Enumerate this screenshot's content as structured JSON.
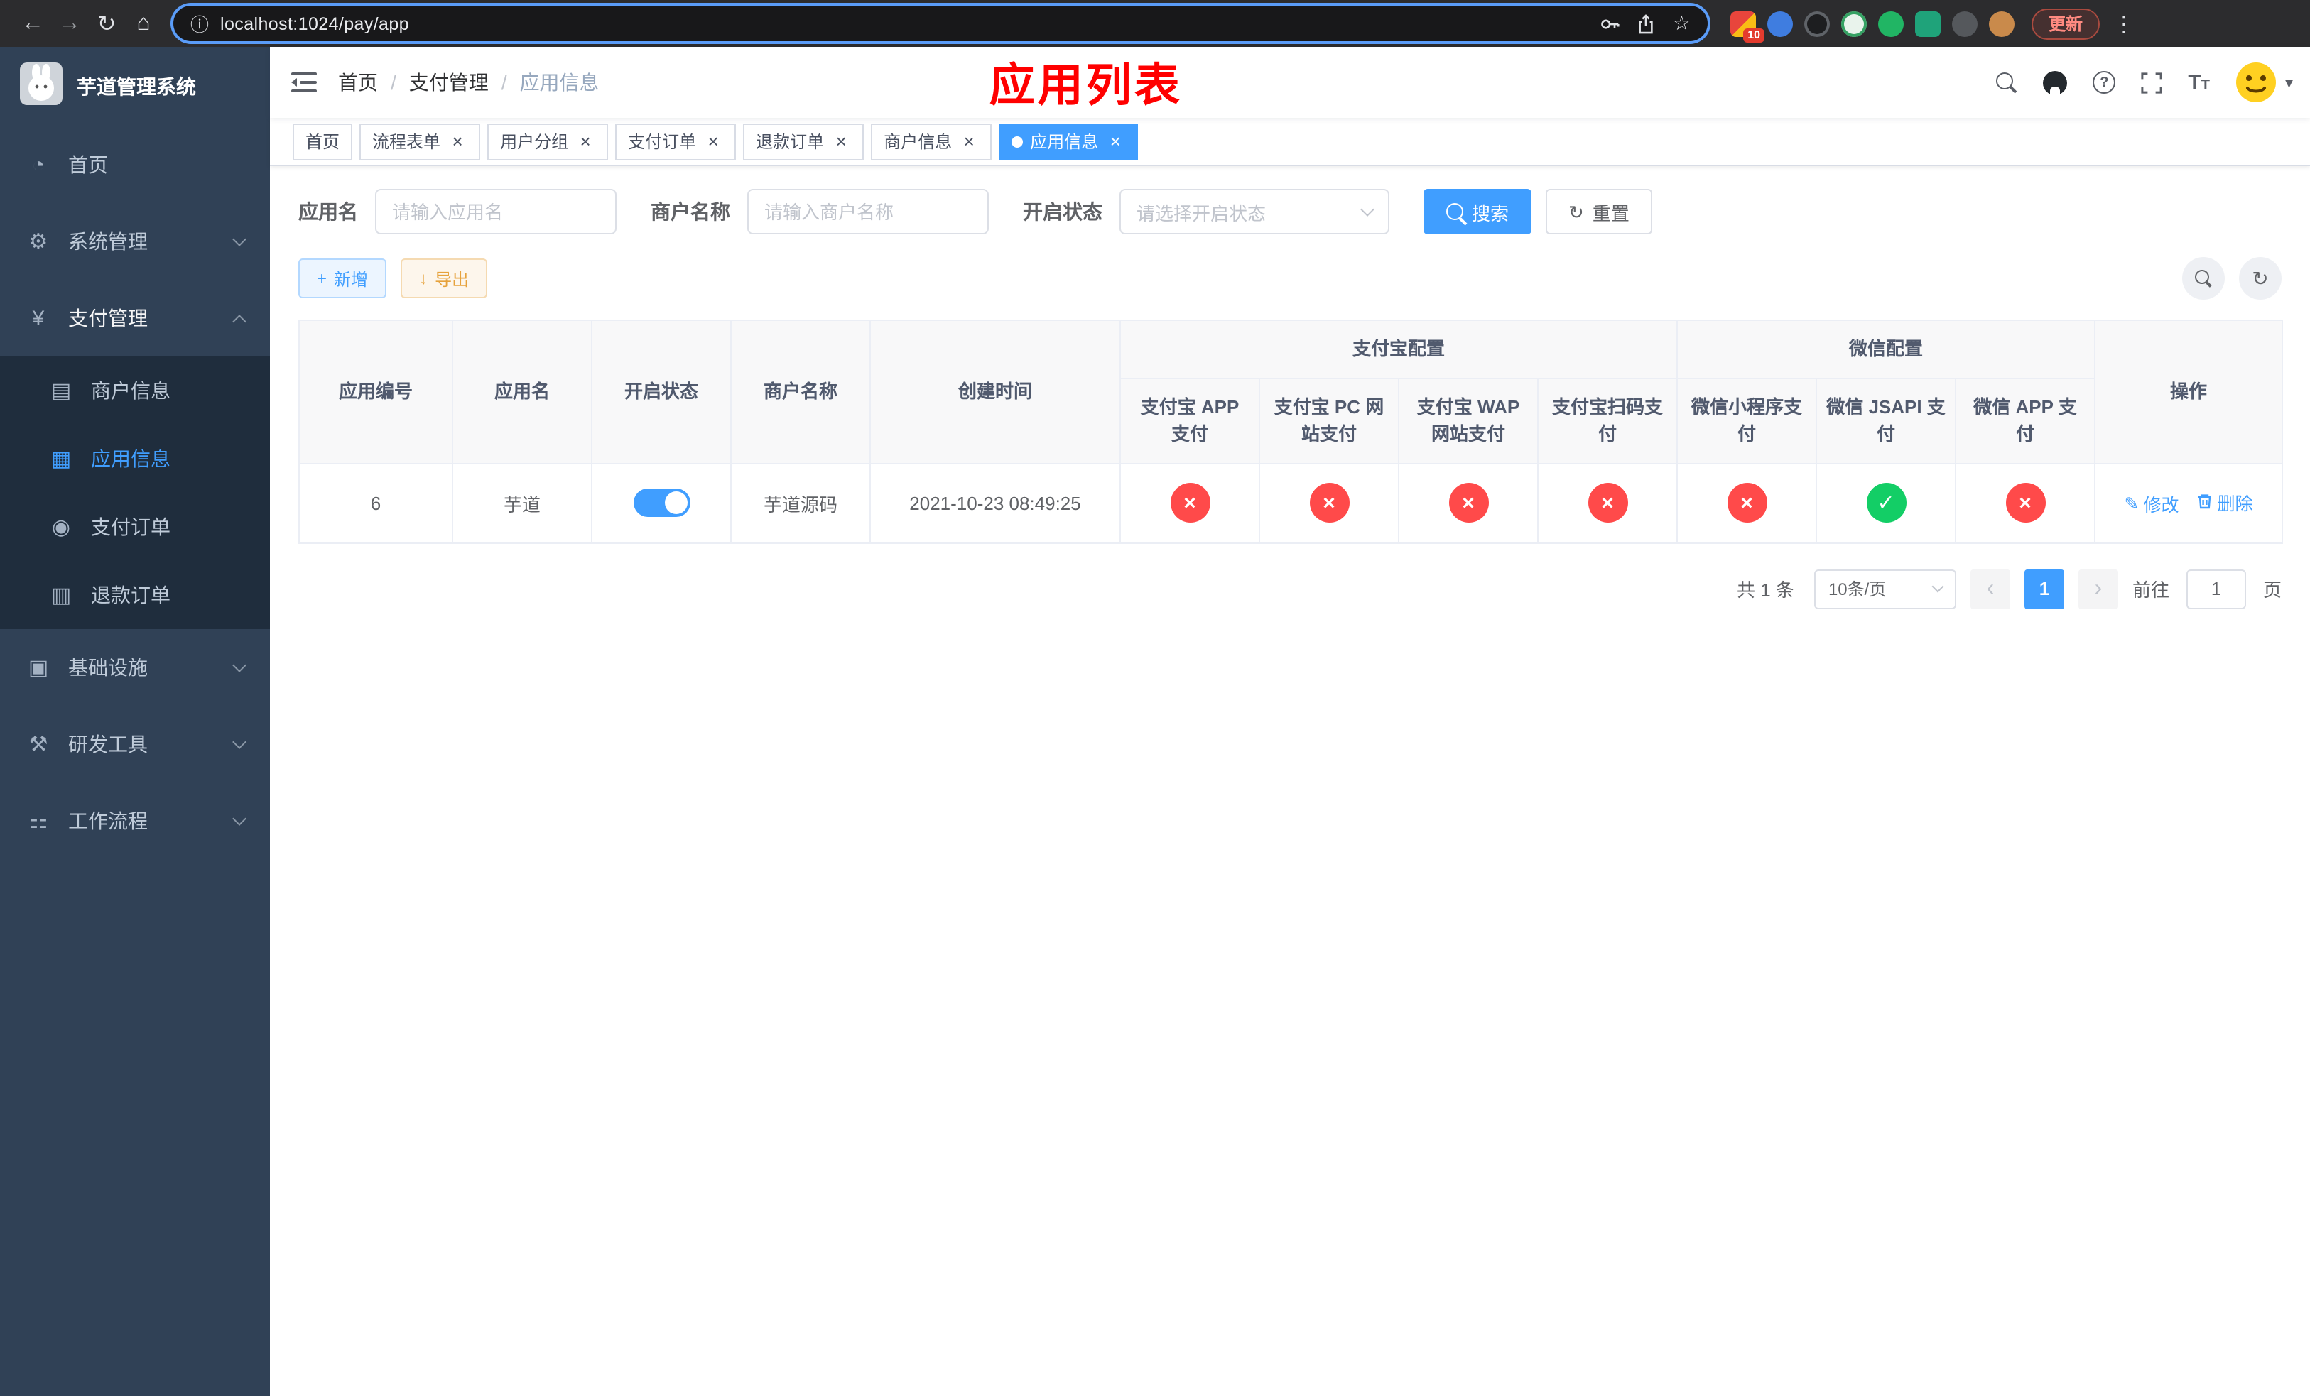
{
  "browser": {
    "url": "localhost:1024/pay/app",
    "update_label": "更新",
    "extension_badge": "10"
  },
  "icons": {
    "back": "←",
    "forward": "→",
    "reload": "↻",
    "home": "⌂",
    "info": "ⓘ",
    "star": "☆",
    "dots": "⋮",
    "dashboard": "◔",
    "system": "⚙",
    "payment": "¥",
    "merchant": "▤",
    "app_info": "▦",
    "pay_order": "◉",
    "refund_order": "▥",
    "infra": "▣",
    "devtools": "⚒",
    "workflow": "⚏",
    "plus": "+",
    "download": "↓",
    "refresh": "↻",
    "edit": "✎",
    "check": "✓",
    "cross": "×",
    "close": "×",
    "caret": "▾",
    "question": "?",
    "font_size_big": "T",
    "font_size_small": "T",
    "prev": "‹",
    "next": "›"
  },
  "sidebar": {
    "logo_title": "芋道管理系统",
    "items": [
      {
        "label": "首页"
      },
      {
        "label": "系统管理"
      },
      {
        "label": "支付管理",
        "expanded": true,
        "children": [
          {
            "label": "商户信息"
          },
          {
            "label": "应用信息",
            "active": true
          },
          {
            "label": "支付订单"
          },
          {
            "label": "退款订单"
          }
        ]
      },
      {
        "label": "基础设施"
      },
      {
        "label": "研发工具"
      },
      {
        "label": "工作流程"
      }
    ]
  },
  "header": {
    "breadcrumb": [
      "首页",
      "支付管理",
      "应用信息"
    ],
    "separator": "/",
    "annotation": "应用列表"
  },
  "tabs": [
    {
      "label": "首页",
      "closable": false,
      "active": false
    },
    {
      "label": "流程表单",
      "closable": true,
      "active": false
    },
    {
      "label": "用户分组",
      "closable": true,
      "active": false
    },
    {
      "label": "支付订单",
      "closable": true,
      "active": false
    },
    {
      "label": "退款订单",
      "closable": true,
      "active": false
    },
    {
      "label": "商户信息",
      "closable": true,
      "active": false
    },
    {
      "label": "应用信息",
      "closable": true,
      "active": true
    }
  ],
  "filters": {
    "app_name_label": "应用名",
    "app_name_placeholder": "请输入应用名",
    "merchant_label": "商户名称",
    "merchant_placeholder": "请输入商户名称",
    "status_label": "开启状态",
    "status_placeholder": "请选择开启状态",
    "search_label": "搜索",
    "reset_label": "重置"
  },
  "toolbar": {
    "add_label": "新增",
    "export_label": "导出"
  },
  "table": {
    "col_app_id": "应用编号",
    "col_app_name": "应用名",
    "col_status": "开启状态",
    "col_merchant": "商户名称",
    "col_create_time": "创建时间",
    "group_alipay": "支付宝配置",
    "group_wechat": "微信配置",
    "col_alipay_app": "支付宝 APP 支付",
    "col_alipay_pc": "支付宝 PC 网站支付",
    "col_alipay_wap": "支付宝 WAP 网站支付",
    "col_alipay_scan": "支付宝扫码支付",
    "col_wx_mini": "微信小程序支付",
    "col_wx_jsapi": "微信 JSAPI 支付",
    "col_wx_app": "微信 APP 支付",
    "col_actions": "操作",
    "rows": [
      {
        "app_id": "6",
        "app_name": "芋道",
        "status_on": true,
        "merchant": "芋道源码",
        "create_time": "2021-10-23 08:49:25",
        "alipay_app": false,
        "alipay_pc": false,
        "alipay_wap": false,
        "alipay_scan": false,
        "wx_mini": false,
        "wx_jsapi": true,
        "wx_app": false,
        "edit_label": "修改",
        "delete_label": "删除"
      }
    ]
  },
  "pagination": {
    "total_label": "共 1 条",
    "page_size": "10条/页",
    "current_page": "1",
    "goto_label": "前往",
    "goto_value": "1",
    "page_suffix": "页"
  },
  "colors": {
    "accent": "#409eff",
    "danger": "#ff4a4a",
    "success": "#13ce66",
    "warning": "#e6a23c",
    "sidebar_bg": "#304156",
    "submenu_bg": "#1f2d3d",
    "annotation": "#ff0000"
  }
}
